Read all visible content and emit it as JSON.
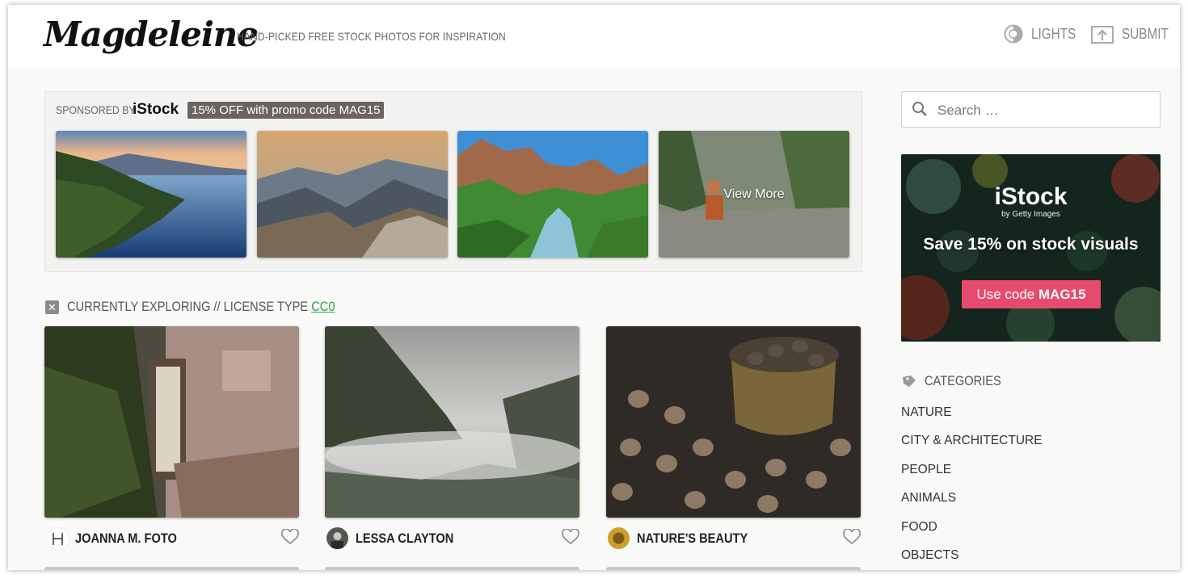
{
  "header": {
    "logo": "Magdeleine",
    "tagline": "HAND-PICKED FREE STOCK PHOTOS FOR INSPIRATION",
    "lights_label": "LIGHTS",
    "submit_label": "SUBMIT"
  },
  "sponsored": {
    "label": "SPONSORED BY",
    "brand": "iStock",
    "promo": "15% OFF with promo code MAG15",
    "view_more": "View More",
    "thumbnails": [
      "lake-forest-sunset",
      "mountain-sunrise",
      "canyon-river",
      "hiker-by-stream"
    ]
  },
  "filter": {
    "prefix": "CURRENTLY EXPLORING // LICENSE TYPE",
    "value": "CC0",
    "link_color": "#2e9a4e"
  },
  "photos": [
    {
      "author": "JOANNA M. FOTO",
      "subject": "ivy-brick-window"
    },
    {
      "author": "LESSA CLAYTON",
      "subject": "foggy-mountain-valley"
    },
    {
      "author": "NATURE'S BEAUTY",
      "subject": "acorns-thankful-bowl"
    }
  ],
  "search": {
    "placeholder": "Search …"
  },
  "ad": {
    "logo": "iStock",
    "byline": "by Getty Images",
    "headline": "Save 15% on stock visuals",
    "cta_prefix": "Use code ",
    "cta_code": "MAG15",
    "cta_color": "#e64b6d"
  },
  "categories": {
    "title": "CATEGORIES",
    "items": [
      "NATURE",
      "CITY & ARCHITECTURE",
      "PEOPLE",
      "ANIMALS",
      "FOOD",
      "OBJECTS"
    ]
  }
}
